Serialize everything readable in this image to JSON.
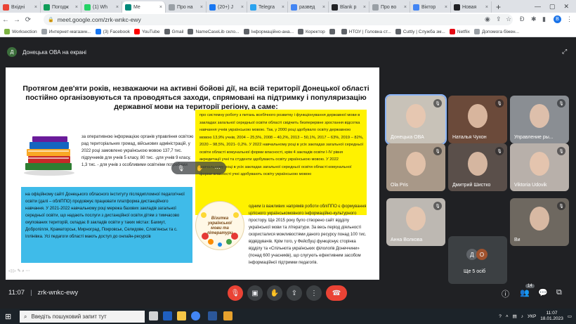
{
  "tabs": [
    {
      "label": "Вхідні",
      "color": "#ea4335"
    },
    {
      "label": "Погодж",
      "color": "#0f9d58"
    },
    {
      "label": "(1) Wh",
      "color": "#25d366"
    },
    {
      "label": "Me",
      "color": "#00897b",
      "active": true
    },
    {
      "label": "Про на",
      "color": "#9aa0a6"
    },
    {
      "label": "(20+) J",
      "color": "#1877f2"
    },
    {
      "label": "Telegra",
      "color": "#2aa3ef"
    },
    {
      "label": "развед",
      "color": "#4285f4"
    },
    {
      "label": "Blank p",
      "color": "#202124"
    },
    {
      "label": "Про во",
      "color": "#9aa0a6"
    },
    {
      "label": "Віктор",
      "color": "#4285f4"
    },
    {
      "label": "Новая",
      "color": "#202124"
    }
  ],
  "address": {
    "url": "meet.google.com/zrk-wnkc-ewy"
  },
  "bookmarks": [
    {
      "label": "Worksection",
      "color": "#7cb342"
    },
    {
      "label": "Интернет-магазин...",
      "color": "#9aa0a6"
    },
    {
      "label": "(3) Facebook",
      "color": "#1877f2"
    },
    {
      "label": "YouTube",
      "color": "#ff0000"
    },
    {
      "label": "Gmail",
      "color": "#5f6368"
    },
    {
      "label": "NameCaseLib скло...",
      "color": "#5f6368"
    },
    {
      "label": "Інформаційно-ана...",
      "color": "#5f6368"
    },
    {
      "label": "Коректор",
      "color": "#5f6368"
    },
    {
      "label": "",
      "color": "#5f6368"
    },
    {
      "label": "НТОУ | Головна ст...",
      "color": "#5f6368"
    },
    {
      "label": "Cuttly | Служба зм...",
      "color": "#5f6368"
    },
    {
      "label": "Netflix",
      "color": "#e50914"
    },
    {
      "label": "Допомога біжен...",
      "color": "#9aa0a6"
    }
  ],
  "meet": {
    "presenter_initial": "Д",
    "presenting_label": "Донецька ОВА на екрані",
    "time": "11:07",
    "code": "zrk-wnkc-ewy",
    "people_count": "14",
    "hidden_count": "Ще 5 осіб"
  },
  "slide": {
    "title": "Протягом дев'яти років, незважаючи на активні бойові дії, на всій території Донецької області постійно організовуються та проводяться заходи, спрямовані на підтримку і популяризацію державної мови на території регіону, а саме:",
    "yellow_text": "про системну роботу з питань всебічного розвитку і функціонування державної мови в закладах загальної середньої освіти області свідчить безперервне зростання відсотка навчання учнів українською мовою. Так, у 2000 році здобувало освіту державною мовою 13,9% учнів, 2004 – 25,5%, 2008 – 40,2%, 2013 – 50,1%, 2017 – 63%, 2019 – 82%, 2020 – 98,5%, 2021- 0,2%. У 2022 навчальному році в усіх закладах загальної середньої освіти області комунальної форми власності, крім 4 закладів освіти І-IV рівня акредитації учні та студенти здобувають освіту українською мовою. У 2022 навчальному році в усіх закладах загальної середньої освіти області комунальної форми власності учні здобувають освіту українською мовою",
    "left_text": "за оперативною інформацією органів управління освітою рад територіальних громад, військових адміністрацій, у 2022 році замовлено українською мовою 137,7 тис. підручників для учнів 5 класу, 80 тис. -для учнів 9 класу, 1,3 тис. - для учнів з особливими освітніми потребами",
    "blue_text": "на офіційному сайті Донецького обласного інституту післядипломної педагогічної освіти (далі – обліППО) продовжує працювати платформа дистанційного навчання. У 2021-2022 навчальному році мережа базових закладів загальної середньої освіти, що надають послуги з дистанційної освіти дітям з тимчасово окупованих територій, складає 8 закладів освіти у таких містах: Бахмут, Добропілля, Краматорськ, Мирноград, Покровськ, Селидове, Слов'янськ та с. Іллінівка. Усі педагоги області мають доступ до онлайн-ресурсів",
    "right_text": "одним із важливих напрямів роботи обліППО є формування цілісного українськомовного інформаційно-культурного простору. Ще 2015 року було створено сайт відділу української мови та літератури. За весь період діяльності скористалися можливостями даного ресурсу понад 100 тис. відвідувачів. Крім того, у Фейсбуці функціонує сторінка відділу та «Спільнота українських філологів Донеччини» (понад 600 учасників), що слугують ефективним засобом інформаційної підтримки педагогів.",
    "badge_text": "Візитка української мови та літератури"
  },
  "participants": [
    {
      "name": "Донецька ОВА",
      "bg": "#c8c2b8"
    },
    {
      "name": "Наталья Чухон",
      "bg": "#6b4a3a"
    },
    {
      "name": "Управление ры...",
      "bg": "#8a8e93"
    },
    {
      "name": "Ola Pris",
      "bg": "#a89888"
    },
    {
      "name": "Дмитрий Шистко",
      "bg": "#5a4f4a"
    },
    {
      "name": "Viktoria Udovik",
      "bg": "#b8b0aa"
    },
    {
      "name": "Анна Волкова",
      "bg": "#bdb8b2"
    },
    {
      "name": "Ви",
      "bg": "#6e6860"
    }
  ],
  "small_avatars": [
    {
      "letter": "Д",
      "color": "#5f6368"
    },
    {
      "letter": "О",
      "color": "#a0522d"
    }
  ],
  "taskbar": {
    "search_placeholder": "Введіть пошуковий запит тут",
    "lang": "УКР",
    "time": "11:07",
    "date": "18.01.2023"
  }
}
